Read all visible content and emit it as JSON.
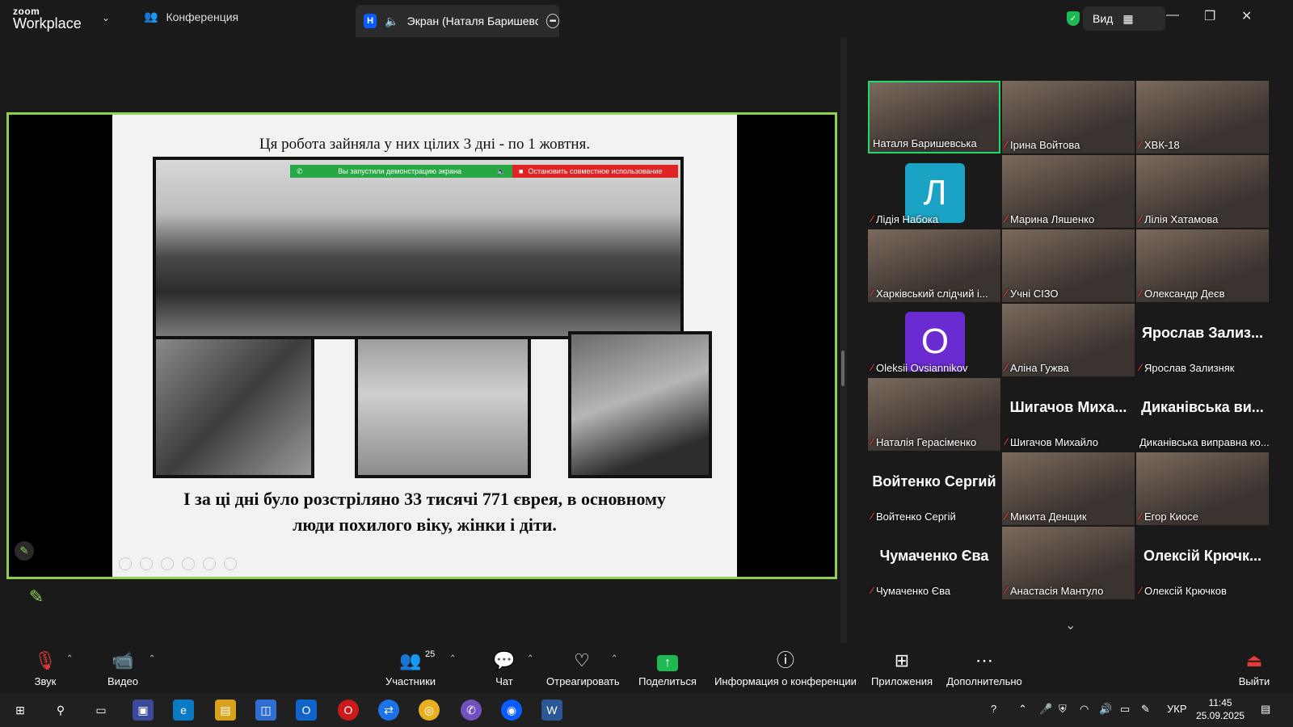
{
  "app": {
    "logo_top": "zoom",
    "logo_bottom": "Workplace"
  },
  "tabs": {
    "conference": "Конференция",
    "screen_badge": "Н",
    "screen": "Экран (Наталя Баришевськ"
  },
  "view": {
    "label": "Вид"
  },
  "slide": {
    "title": "Ця робота зайняла у них цілих 3 дні - по 1 жовтня.",
    "sharebar_started": "Вы запустили демонстрацию экрана",
    "sharebar_stop": "Остановить совместное использование",
    "caption_line1": "І за ці дні було розстріляно 33 тисячі 771 єврея, в основному",
    "caption_line2": "люди похилого віку, жінки і діти."
  },
  "gallery": [
    {
      "name": "Наталя Баришевська",
      "type": "video",
      "muted": false,
      "active": true
    },
    {
      "name": "Ірина Войтова",
      "type": "video",
      "muted": true
    },
    {
      "name": "ХВК-18",
      "type": "video",
      "muted": true
    },
    {
      "name": "Лідія Набока",
      "type": "avatar",
      "letter": "Л",
      "color": "#1aa3c4",
      "muted": true
    },
    {
      "name": "Марина Ляшенко",
      "type": "video",
      "muted": true
    },
    {
      "name": "Лілія Хатамова",
      "type": "video",
      "muted": true
    },
    {
      "name": "Харківський слідчий і...",
      "type": "video",
      "muted": true
    },
    {
      "name": "Учні СІЗО",
      "type": "video",
      "muted": true
    },
    {
      "name": "Олександр Деєв",
      "type": "photo",
      "muted": true
    },
    {
      "name": "Oleksii Ovsiannikov",
      "type": "avatar",
      "letter": "O",
      "color": "#6a2bd1",
      "muted": true
    },
    {
      "name": "Аліна Гужва",
      "type": "video",
      "muted": true
    },
    {
      "name": "Ярослав Зализняк",
      "type": "text",
      "big": "Ярослав Зализ...",
      "muted": true
    },
    {
      "name": "Наталія Герасіменко",
      "type": "photo",
      "muted": true
    },
    {
      "name": "Шигачов Михайло",
      "type": "text",
      "big": "Шигачов Миха...",
      "muted": true
    },
    {
      "name": "Диканівська виправна ко...",
      "type": "text",
      "big": "Диканівська ви...",
      "muted": false
    },
    {
      "name": "Войтенко Сергій",
      "type": "text",
      "big": "Войтенко Сергий",
      "muted": true
    },
    {
      "name": "Микита Денщик",
      "type": "photo",
      "muted": true
    },
    {
      "name": "Егор Киосе",
      "type": "photo",
      "muted": true
    },
    {
      "name": "Чумаченко Єва",
      "type": "text",
      "big": "Чумаченко Єва",
      "muted": true
    },
    {
      "name": "Анастасія Мантуло",
      "type": "photo",
      "muted": true
    },
    {
      "name": "Олексій Крючков",
      "type": "text",
      "big": "Олексій Крючк...",
      "muted": true
    }
  ],
  "toolbar": {
    "audio": "Звук",
    "video": "Видео",
    "participants": "Участники",
    "participants_count": "25",
    "chat": "Чат",
    "react": "Отреагировать",
    "share": "Поделиться",
    "info": "Информация о конференции",
    "apps": "Приложения",
    "more": "Дополнительно",
    "leave": "Выйти"
  },
  "taskbar": {
    "lang": "УКР",
    "time": "11:45",
    "date": "25.09.2025"
  },
  "colors": {
    "accent": "#8fd14f",
    "active": "#1fdc6a",
    "share": "#1fb954",
    "mute": "#e43a3a"
  }
}
